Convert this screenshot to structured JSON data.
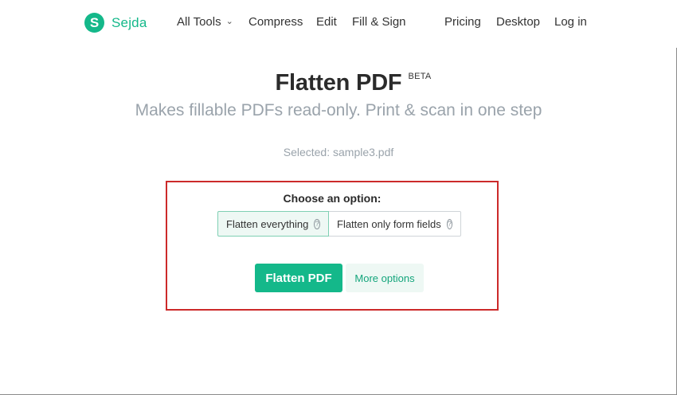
{
  "brand": {
    "logo_letter": "S",
    "name": "Sejda",
    "accent_color": "#14b88a"
  },
  "nav": {
    "all_tools": "All Tools",
    "all_tools_icon": "chevron-down-icon",
    "compress": "Compress",
    "edit": "Edit",
    "fill_sign": "Fill & Sign",
    "pricing": "Pricing",
    "desktop": "Desktop",
    "login": "Log in"
  },
  "page": {
    "title": "Flatten PDF",
    "badge": "BETA",
    "subtitle": "Makes fillable PDFs read-only. Print & scan in one step",
    "selected_file": "Selected: sample3.pdf"
  },
  "options": {
    "heading": "Choose an option:",
    "choices": [
      {
        "label": "Flatten everything",
        "selected": true,
        "icon": "question-circle-icon"
      },
      {
        "label": "Flatten only form fields",
        "selected": false,
        "icon": "question-circle-icon"
      }
    ],
    "help_glyph": "?",
    "primary_button": "Flatten PDF",
    "secondary_button": "More options",
    "highlight_color": "#cc2a2a"
  }
}
